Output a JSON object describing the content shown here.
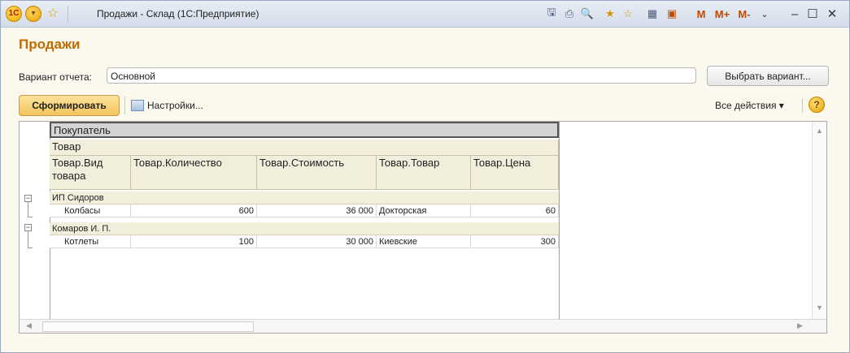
{
  "window": {
    "title": "Продажи - Склад  (1С:Предприятие)",
    "logo_text": "1C",
    "memory_buttons": [
      "M",
      "M+",
      "M-"
    ]
  },
  "form": {
    "title": "Продажи",
    "variant_label": "Вариант отчета:",
    "variant_value": "Основной",
    "choose_variant_button": "Выбрать вариант...",
    "generate_button": "Сформировать",
    "settings_button": "Настройки...",
    "all_actions": "Все действия ▾",
    "help": "?"
  },
  "report": {
    "header_row1": "Покупатель",
    "header_row2": "Товар",
    "columns": [
      "Товар.Вид товара",
      "Товар.Количество",
      "Товар.Стоимость",
      "Товар.Товар",
      "Товар.Цена"
    ],
    "groups": [
      {
        "name": "ИП Сидоров",
        "rows": [
          {
            "kind": "Колбасы",
            "qty": "600",
            "cost": "36 000",
            "item": "Докторская",
            "price": "60"
          }
        ]
      },
      {
        "name": "Комаров И. П.",
        "rows": [
          {
            "kind": "Котлеты",
            "qty": "100",
            "cost": "30 000",
            "item": "Киевские",
            "price": "300"
          }
        ]
      }
    ]
  }
}
